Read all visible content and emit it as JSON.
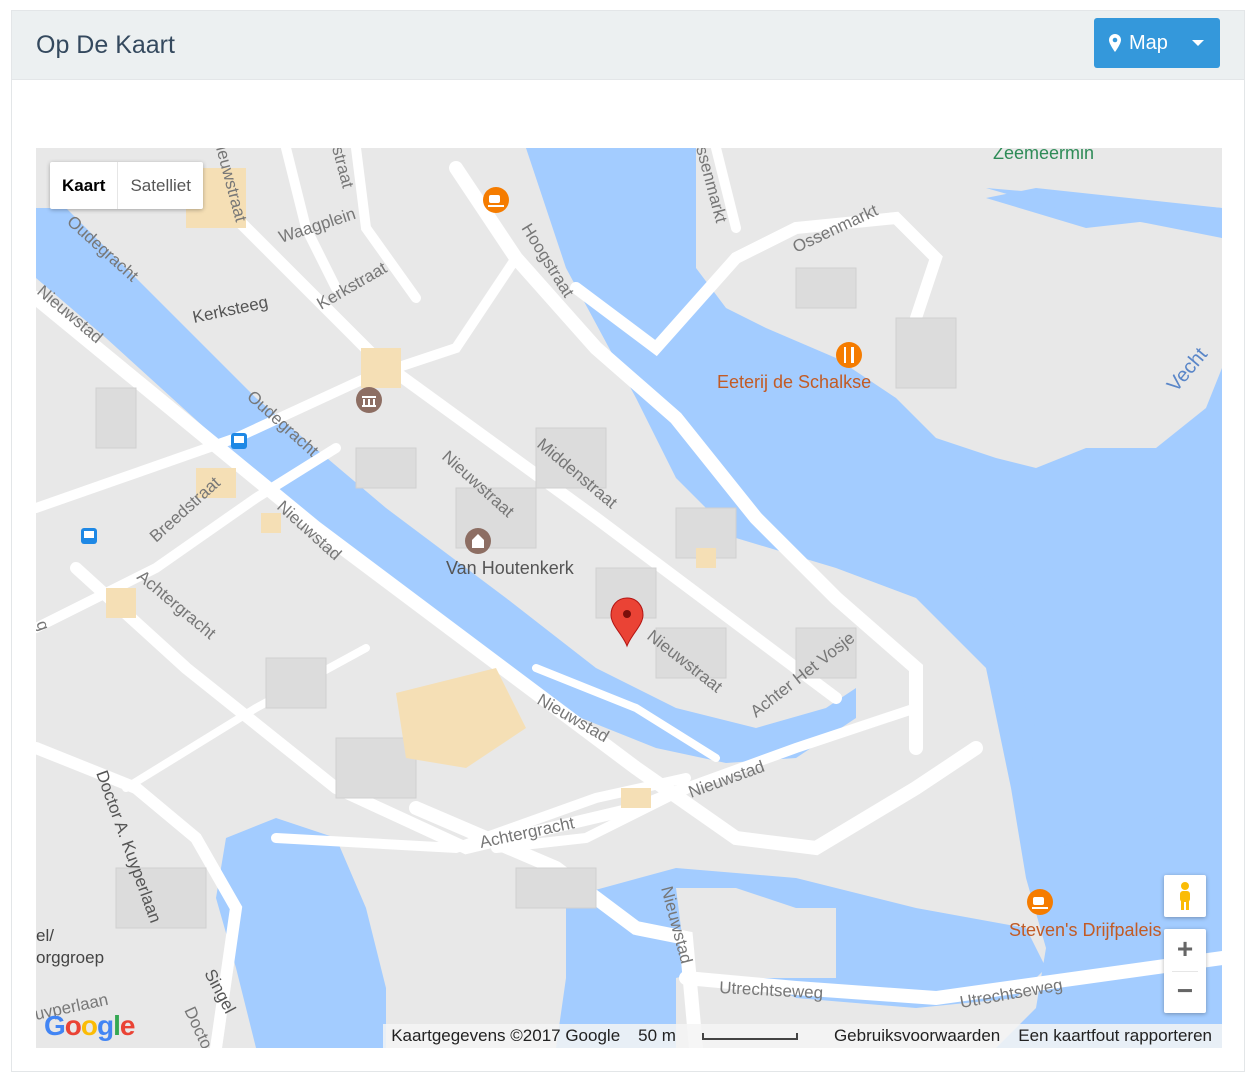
{
  "panel": {
    "title": "Op De Kaart",
    "map_button_label": "Map"
  },
  "map": {
    "type_controls": {
      "map": "Kaart",
      "satellite": "Satelliet"
    },
    "streets": {
      "oudegracht_top": "Oudegracht",
      "oudegracht_mid": "Oudegracht",
      "nieuwstad_top": "Nieuwstad",
      "nieuwstad_mid": "Nieuwstad",
      "nieuwstad_low": "Nieuwstad",
      "nieuwstad_right": "Nieuwstad",
      "nieuwstad_vertical": "Nieuwstad",
      "kerksteeg": "Kerksteeg",
      "kerkstraat": "Kerkstraat",
      "waagplein": "Waagplein",
      "hoogstraat": "Hoogstraat",
      "ossenmarkt": "Ossenmarkt",
      "ossenmarkt_2": "ssenmarkt",
      "nieuwstraat_1": "Nieuwstraat",
      "nieuwstraat_2": "Nieuwstraat",
      "nieuwstraat_top": "ieuwstraat",
      "middenstraat": "Middenstraat",
      "breedstraat": "Breedstraat",
      "achtergracht_1": "Achtergracht",
      "achtergracht_2": "Achtergracht",
      "achter_het_vosje": "Achter Het Vosje",
      "doctor_kuyperlaan": "Doctor A. Kuyperlaan",
      "utrechtseweg_1": "Utrechtseweg",
      "utrechtseweg_2": "Utrechtseweg",
      "singel": "Singel",
      "docto": "Docto",
      "vecht": "Vecht",
      "zorggroep_1": "el/",
      "zorggroep_2": "orggroep",
      "yperlaan": "uyperlaan",
      "straat_top": "straat",
      "g_edge": "g"
    },
    "places": {
      "van_houtenkerk": "Van Houtenkerk",
      "eeterij": "Eeterij de Schalkse",
      "stevens": "Steven's Drijfpaleis",
      "zeemeermin": "Zeemeermin"
    },
    "icons": [
      "coffee-icon",
      "restaurant-icon",
      "museum-icon",
      "church-icon",
      "bus-stop-icon",
      "pegman-icon",
      "map-marker-icon"
    ],
    "zoom_in": "+",
    "zoom_out": "−",
    "attribution": {
      "data": "Kaartgegevens ©2017 Google",
      "scale": "50 m",
      "terms": "Gebruiksvoorwaarden",
      "report": "Een kaartfout rapporteren"
    },
    "google_logo": "Google",
    "colors": {
      "water": "#a3ccff",
      "land": "#e8e8e8",
      "road": "#ffffff",
      "poi_orange": "#f57c00",
      "poi_brown": "#8d6e63",
      "marker": "#ea4335",
      "label_poi": "#c25b25"
    }
  }
}
